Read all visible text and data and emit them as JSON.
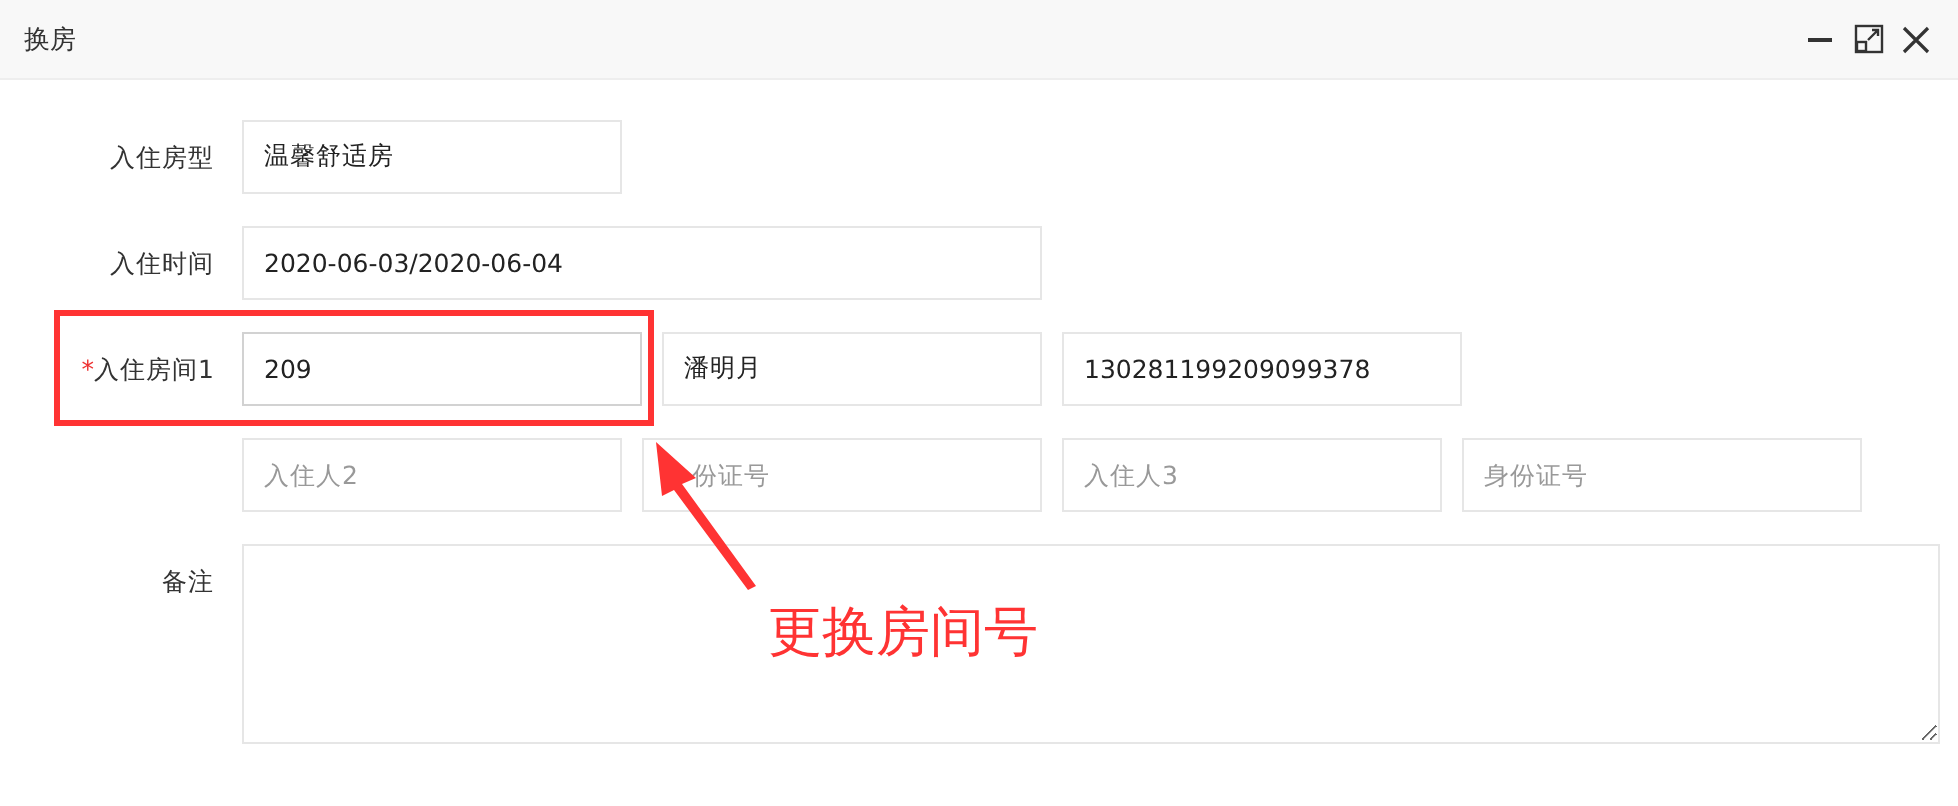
{
  "window": {
    "title": "换房"
  },
  "form": {
    "rows": [
      {
        "label": "入住房型",
        "fields": [
          {
            "value": "温馨舒适房"
          }
        ]
      },
      {
        "label": "入住时间",
        "fields": [
          {
            "value": "2020-06-03/2020-06-04"
          }
        ]
      },
      {
        "label": "入住房间1",
        "required_mark": "*",
        "fields": [
          {
            "value": "209"
          },
          {
            "value": "潘明月"
          },
          {
            "value": "130281199209099378"
          }
        ]
      },
      {
        "fields": [
          {
            "placeholder": "入住人2"
          },
          {
            "placeholder": "份证号"
          },
          {
            "placeholder": "入住人3"
          },
          {
            "placeholder": "身份证号"
          }
        ]
      }
    ],
    "remark": {
      "label": "备注"
    }
  },
  "callout": {
    "text": "更换房间号"
  }
}
